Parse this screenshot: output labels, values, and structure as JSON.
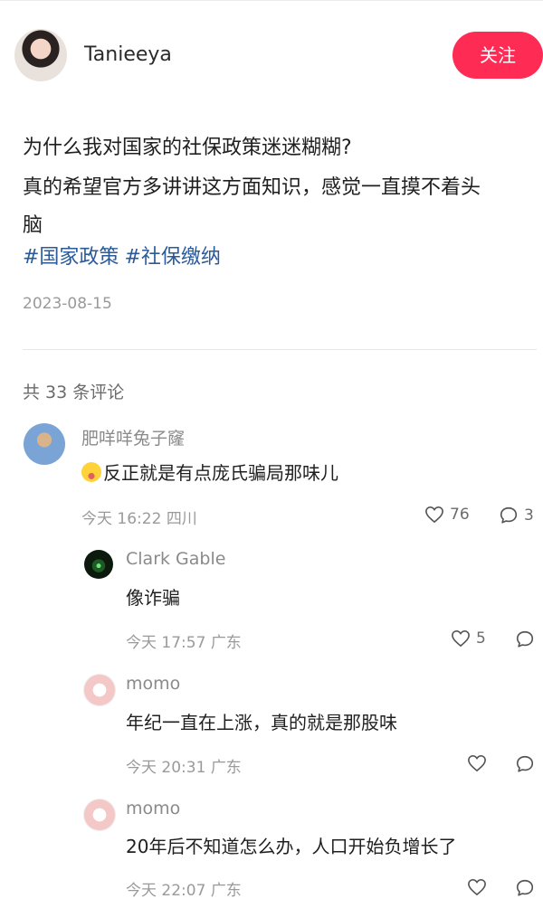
{
  "author": {
    "name": "Tanieeya",
    "follow_label": "关注"
  },
  "post": {
    "lines": [
      "为什么我对国家的社保政策迷迷糊糊?",
      "真的希望官方多讲讲这方面知识，感觉一直摸不着头",
      "脑"
    ],
    "tags": [
      "#国家政策",
      "#社保缴纳"
    ],
    "date": "2023-08-15"
  },
  "comments_header": "共 33 条评论",
  "comments": [
    {
      "name": "肥咩咩兔子窿",
      "text": "反正就是有点庞氏骗局那味儿",
      "time": "今天 16:22",
      "location": "四川",
      "likes": "76",
      "replies": "3"
    },
    {
      "name": "Clark Gable",
      "text": "像诈骗",
      "time": "今天 17:57",
      "location": "广东",
      "likes": "5",
      "replies": ""
    },
    {
      "name": "momo",
      "text": "年纪一直在上涨，真的就是那股味",
      "time": "今天 20:31",
      "location": "广东",
      "likes": "",
      "replies": ""
    },
    {
      "name": "momo",
      "text": "20年后不知道怎么办，人口开始负增长了",
      "time": "今天 22:07",
      "location": "广东",
      "likes": "",
      "replies": ""
    }
  ],
  "icons": {
    "like": "heart-outline-icon",
    "reply": "speech-bubble-icon",
    "emoji": "crying-face-icon"
  },
  "colors": {
    "accent": "#fe2c55",
    "tag": "#2a5a9a",
    "muted": "#9a9a9a"
  }
}
